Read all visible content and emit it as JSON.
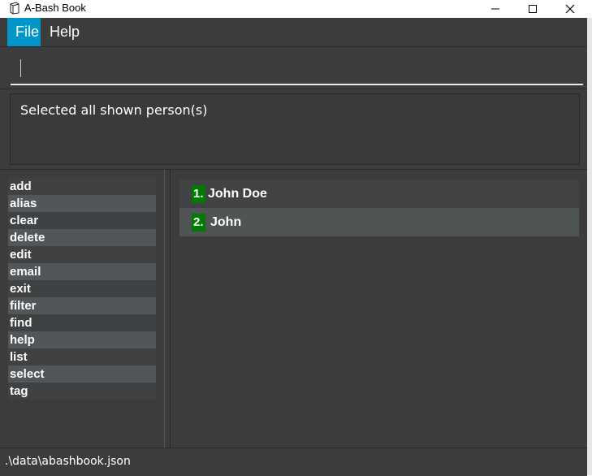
{
  "window": {
    "title": "A-Bash Book",
    "icon": "book-icon",
    "controls": {
      "minimize": "minimize-icon",
      "maximize": "maximize-icon",
      "close": "close-icon"
    }
  },
  "menubar": {
    "file": "File",
    "help": "Help"
  },
  "command_box": {
    "value": "",
    "placeholder": ""
  },
  "result_display": {
    "message": "Selected all shown person(s)"
  },
  "command_list": [
    "add",
    "alias",
    "clear",
    "delete",
    "edit",
    "email",
    "exit",
    "filter",
    "find",
    "help",
    "list",
    "select",
    "tag"
  ],
  "person_list": [
    {
      "index": "1.",
      "name": "John Doe"
    },
    {
      "index": "2.",
      "name": "John"
    }
  ],
  "status_bar": {
    "file_path": ".\\data\\abashbook.json"
  },
  "colors": {
    "background": "#3c3c3c",
    "menu_highlight": "#0096c9",
    "index_badge": "#007a00"
  }
}
